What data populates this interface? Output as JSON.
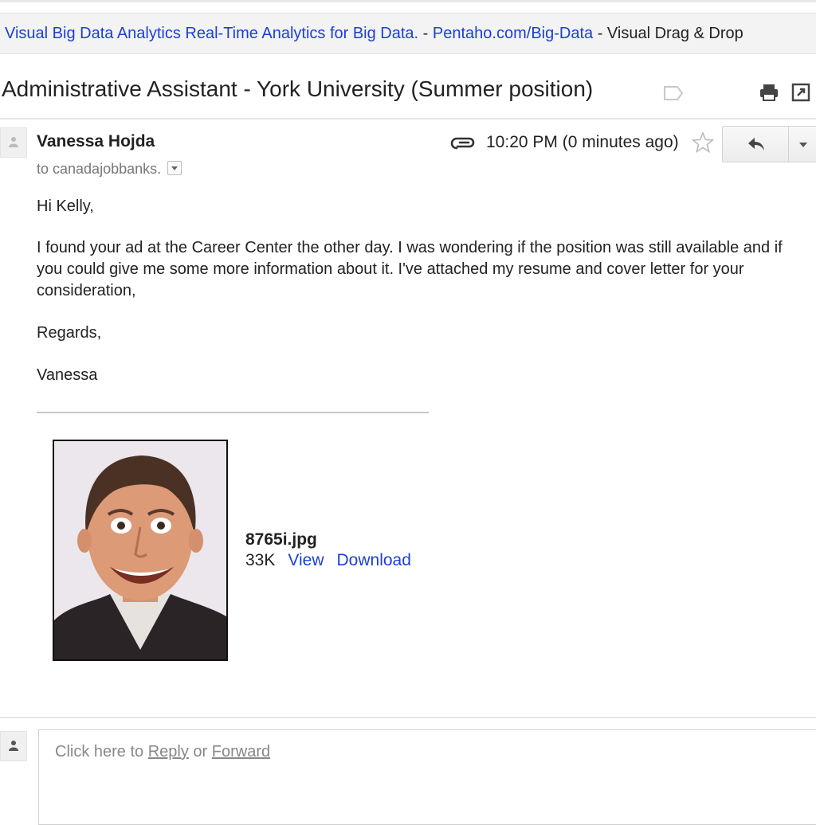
{
  "ad": {
    "title": "Visual Big Data Analytics Real-Time Analytics for Big Data.",
    "separator1": " - ",
    "url": "Pentaho.com/Big-Data",
    "separator2": " - ",
    "description": "Visual Drag & Drop"
  },
  "email": {
    "subject": "Administrative Assistant - York University (Summer position)",
    "sender": "Vanessa Hojda",
    "to": "to canadajobbanks.",
    "time": "10:20 PM (0 minutes ago)",
    "greeting": "Hi Kelly,",
    "paragraph": "I found your ad at the Career Center the other day. I was wondering if the position was still available and if you could give me some more information about it. I've attached my resume and cover letter for your consideration,",
    "closing": "Regards,",
    "signature": "Vanessa"
  },
  "attachment": {
    "filename": "8765i.jpg",
    "size": "33K",
    "view_label": "View",
    "download_label": "Download"
  },
  "reply": {
    "prefix": "Click here to ",
    "reply_label": "Reply",
    "middle": " or ",
    "forward_label": "Forward"
  },
  "icons": {
    "label": "label-icon",
    "print": "print-icon",
    "popout": "new-window-icon",
    "attachment": "paperclip-icon",
    "star": "star-icon",
    "reply": "reply-arrow-icon",
    "avatar": "person-icon"
  },
  "colors": {
    "link": "#1a3fd8",
    "text": "#222222",
    "muted": "#777777"
  }
}
